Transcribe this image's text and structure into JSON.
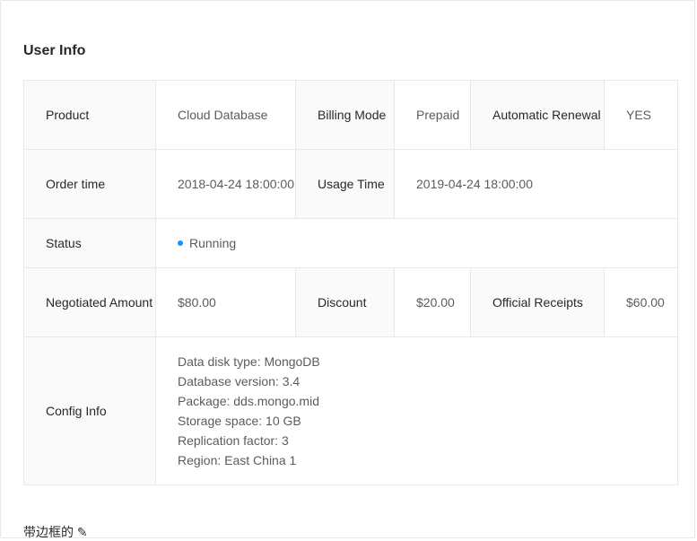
{
  "section": {
    "title": "User Info"
  },
  "row1": {
    "product_label": "Product",
    "product_value": "Cloud Database",
    "billing_label": "Billing Mode",
    "billing_value": "Prepaid",
    "renewal_label": "Automatic Renewal",
    "renewal_value": "YES"
  },
  "row2": {
    "order_label": "Order time",
    "order_value": "2018-04-24 18:00:00",
    "usage_label": "Usage Time",
    "usage_value": "2019-04-24 18:00:00"
  },
  "row3": {
    "status_label": "Status",
    "status_value": "Running",
    "status_color": "#1890ff"
  },
  "row4": {
    "negotiated_label": "Negotiated Amount",
    "negotiated_value": "$80.00",
    "discount_label": "Discount",
    "discount_value": "$20.00",
    "receipts_label": "Official Receipts",
    "receipts_value": "$60.00"
  },
  "row5": {
    "config_label": "Config Info",
    "config_lines": [
      "Data disk type: MongoDB",
      "Database version: 3.4",
      "Package: dds.mongo.mid",
      "Storage space: 10 GB",
      "Replication factor: 3",
      "Region: East China 1"
    ]
  },
  "footer": {
    "text": "带边框的 ✎"
  }
}
